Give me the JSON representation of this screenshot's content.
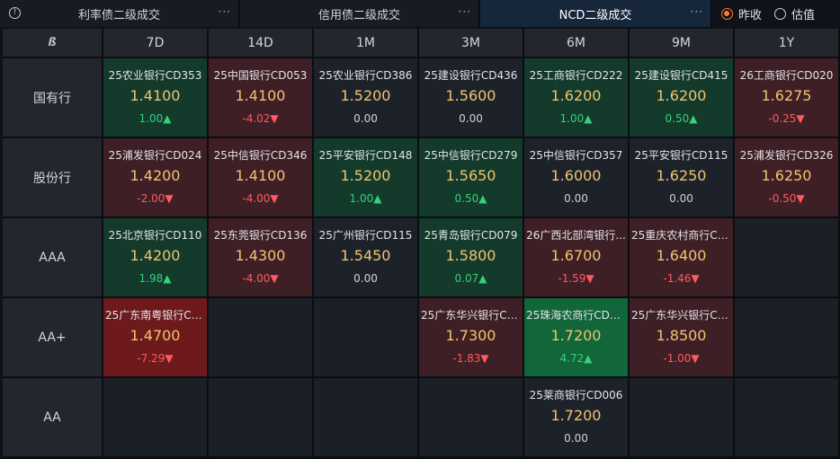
{
  "tabs": [
    {
      "label": "利率债二级成交",
      "active": false
    },
    {
      "label": "信用债二级成交",
      "active": false
    },
    {
      "label": "NCD二级成交",
      "active": true
    }
  ],
  "tab_menu_glyph": "···",
  "info_glyph": "!",
  "radio_options": [
    {
      "label": "昨收",
      "selected": true
    },
    {
      "label": "估值",
      "selected": false
    }
  ],
  "corner_logo": "ß",
  "columns": [
    "7D",
    "14D",
    "1M",
    "3M",
    "6M",
    "9M",
    "1Y"
  ],
  "rows": [
    {
      "label": "国有行",
      "cells": [
        {
          "name": "25农业银行CD353",
          "price": "1.4100",
          "change": "1.00▲",
          "dir": "up",
          "tone": "g"
        },
        {
          "name": "25中国银行CD053",
          "price": "1.4100",
          "change": "-4.02▼",
          "dir": "dn",
          "tone": "r"
        },
        {
          "name": "25农业银行CD386",
          "price": "1.5200",
          "change": "0.00",
          "dir": "flat",
          "tone": "nz"
        },
        {
          "name": "25建设银行CD436",
          "price": "1.5600",
          "change": "0.00",
          "dir": "flat",
          "tone": "nz"
        },
        {
          "name": "25工商银行CD222",
          "price": "1.6200",
          "change": "1.00▲",
          "dir": "up",
          "tone": "g"
        },
        {
          "name": "25建设银行CD415",
          "price": "1.6200",
          "change": "0.50▲",
          "dir": "up",
          "tone": "g"
        },
        {
          "name": "26工商银行CD020",
          "price": "1.6275",
          "change": "-0.25▼",
          "dir": "dn",
          "tone": "r"
        }
      ]
    },
    {
      "label": "股份行",
      "cells": [
        {
          "name": "25浦发银行CD024",
          "price": "1.4200",
          "change": "-2.00▼",
          "dir": "dn",
          "tone": "r"
        },
        {
          "name": "25中信银行CD346",
          "price": "1.4100",
          "change": "-4.00▼",
          "dir": "dn",
          "tone": "r"
        },
        {
          "name": "25平安银行CD148",
          "price": "1.5200",
          "change": "1.00▲",
          "dir": "up",
          "tone": "g"
        },
        {
          "name": "25中信银行CD279",
          "price": "1.5650",
          "change": "0.50▲",
          "dir": "up",
          "tone": "g"
        },
        {
          "name": "25中信银行CD357",
          "price": "1.6000",
          "change": "0.00",
          "dir": "flat",
          "tone": "nz"
        },
        {
          "name": "25平安银行CD115",
          "price": "1.6250",
          "change": "0.00",
          "dir": "flat",
          "tone": "nz"
        },
        {
          "name": "25浦发银行CD326",
          "price": "1.6250",
          "change": "-0.50▼",
          "dir": "dn",
          "tone": "r"
        }
      ]
    },
    {
      "label": "AAA",
      "cells": [
        {
          "name": "25北京银行CD110",
          "price": "1.4200",
          "change": "1.98▲",
          "dir": "up",
          "tone": "g"
        },
        {
          "name": "25东莞银行CD136",
          "price": "1.4300",
          "change": "-4.00▼",
          "dir": "dn",
          "tone": "r"
        },
        {
          "name": "25广州银行CD115",
          "price": "1.5450",
          "change": "0.00",
          "dir": "flat",
          "tone": "nz"
        },
        {
          "name": "25青岛银行CD079",
          "price": "1.5800",
          "change": "0.07▲",
          "dir": "up",
          "tone": "g"
        },
        {
          "name": "26广西北部湾银行...",
          "price": "1.6700",
          "change": "-1.59▼",
          "dir": "dn",
          "tone": "r"
        },
        {
          "name": "25重庆农村商行CD...",
          "price": "1.6400",
          "change": "-1.46▼",
          "dir": "dn",
          "tone": "r"
        },
        null
      ]
    },
    {
      "label": "AA+",
      "cells": [
        {
          "name": "25广东南粤银行CD...",
          "price": "1.4700",
          "change": "-7.29▼",
          "dir": "dn",
          "tone": "rg"
        },
        null,
        null,
        {
          "name": "25广东华兴银行CD...",
          "price": "1.7300",
          "change": "-1.83▼",
          "dir": "dn",
          "tone": "r"
        },
        {
          "name": "25珠海农商行CD011",
          "price": "1.7200",
          "change": "4.72▲",
          "dir": "up",
          "tone": "gg"
        },
        {
          "name": "25广东华兴银行CD...",
          "price": "1.8500",
          "change": "-1.00▼",
          "dir": "dn",
          "tone": "r"
        },
        null
      ]
    },
    {
      "label": "AA",
      "cells": [
        null,
        null,
        null,
        null,
        {
          "name": "25莱商银行CD006",
          "price": "1.7200",
          "change": "0.00",
          "dir": "flat",
          "tone": "nz"
        },
        null,
        null
      ]
    }
  ]
}
